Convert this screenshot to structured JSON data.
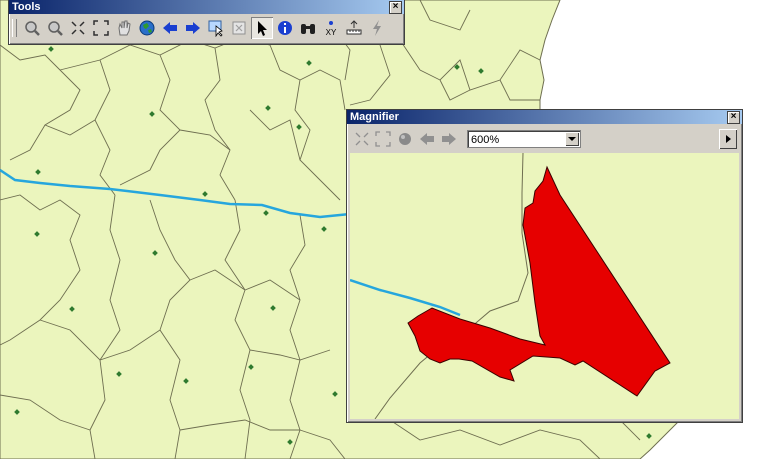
{
  "tools_window": {
    "title": "Tools",
    "close_glyph": "×",
    "buttons": [
      {
        "name": "zoom-in-icon"
      },
      {
        "name": "zoom-out-icon"
      },
      {
        "name": "fixed-zoom-in-icon"
      },
      {
        "name": "fixed-zoom-out-icon"
      },
      {
        "name": "pan-hand-icon"
      },
      {
        "name": "full-extent-globe-icon"
      },
      {
        "name": "back-arrow-icon"
      },
      {
        "name": "forward-arrow-icon"
      },
      {
        "name": "select-features-icon"
      },
      {
        "name": "clear-selection-icon"
      },
      {
        "name": "select-elements-pointer-icon",
        "active": true
      },
      {
        "name": "identify-icon"
      },
      {
        "name": "find-binoculars-icon"
      },
      {
        "name": "go-to-xy-icon",
        "label": "XY"
      },
      {
        "name": "measure-icon"
      },
      {
        "name": "hyperlink-lightning-icon"
      }
    ]
  },
  "magnifier_window": {
    "title": "Magnifier",
    "close_glyph": "×",
    "zoom_level": "600%"
  },
  "colors": {
    "map_fill": "#ebf5bd",
    "boundary": "#6e6e50",
    "river": "#26a6dd",
    "point": "#2f7a2f",
    "selection": "#e60000",
    "titlebar": "#0a246a"
  }
}
